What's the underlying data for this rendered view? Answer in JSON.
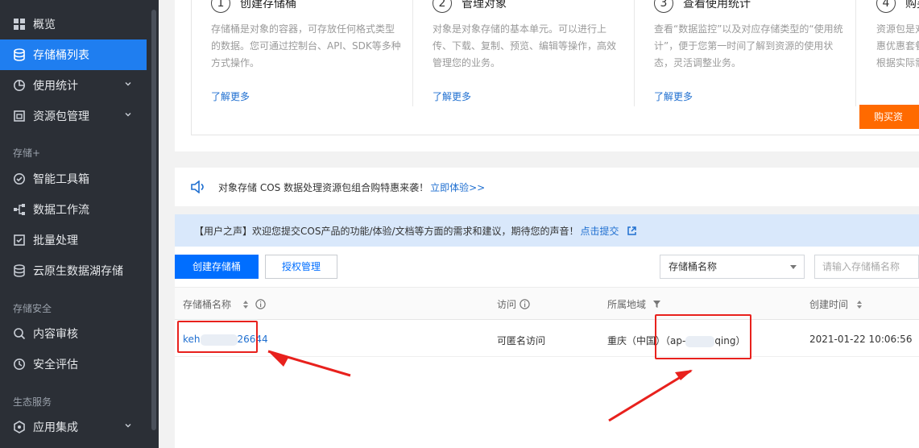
{
  "sidebar": {
    "items": [
      {
        "label": "概览",
        "icon": "grid-icon"
      },
      {
        "label": "存储桶列表",
        "icon": "bucket-icon",
        "active": true
      },
      {
        "label": "使用统计",
        "icon": "pie-chart-icon"
      },
      {
        "label": "资源包管理",
        "icon": "package-icon"
      },
      {
        "label": "智能工具箱",
        "icon": "toolbox-icon"
      },
      {
        "label": "数据工作流",
        "icon": "workflow-icon"
      },
      {
        "label": "批量处理",
        "icon": "checkbox-icon"
      },
      {
        "label": "云原生数据湖存储",
        "icon": "database-icon"
      },
      {
        "label": "内容审核",
        "icon": "search-icon"
      },
      {
        "label": "安全评估",
        "icon": "shield-icon"
      },
      {
        "label": "应用集成",
        "icon": "hexagon-icon"
      }
    ],
    "groups": [
      "存储+",
      "存储安全",
      "生态服务"
    ]
  },
  "steps": [
    {
      "num": "1",
      "title": "创建存储桶",
      "desc": "存储桶是对象的容器，可存放任何格式类型的数据。您可通过控制台、API、SDK等多种方式操作。",
      "more": "了解更多"
    },
    {
      "num": "2",
      "title": "管理对象",
      "desc": "对象是对象存储的基本单元。可以进行上传、下载、复制、预览、编辑等操作，高效管理您的业务。",
      "more": "了解更多"
    },
    {
      "num": "3",
      "title": "查看使用统计",
      "desc": "查看“数据监控”以及对应存储类型的“使用统计”，便于您第一时间了解到资源的使用状态，灵活调整业务。",
      "more": "了解更多"
    },
    {
      "num": "4",
      "title": "购买",
      "desc": "资源包是对\n惠优惠套餐\n根据实际需",
      "buy": "购买资"
    }
  ],
  "notice": {
    "text": "对象存储 COS 数据处理资源包组合购特惠来袭！",
    "link": "立即体验>>"
  },
  "voice": {
    "text": "【用户之声】欢迎您提交COS产品的功能/体验/文档等方面的需求和建议，期待您的声音！",
    "link": "点击提交"
  },
  "toolbar": {
    "create": "创建存储桶",
    "auth": "授权管理",
    "select": "存储桶名称",
    "search_placeholder": "请输入存储桶名称"
  },
  "table": {
    "headers": [
      "存储桶名称",
      "访问",
      "所属地域",
      "创建时间"
    ],
    "rows": [
      {
        "name_a": "keh",
        "name_b": "26644",
        "access": "可匿名访问",
        "region_a": "重庆（中国）（ap-",
        "region_b": "qing）",
        "created": "2021-01-22 10:06:56"
      }
    ]
  },
  "colors": {
    "sidebar": "#2b2f36",
    "active": "#1f7ef0",
    "primary": "#006eff",
    "buy": "#ff6a00",
    "annotation": "#e8211d"
  }
}
